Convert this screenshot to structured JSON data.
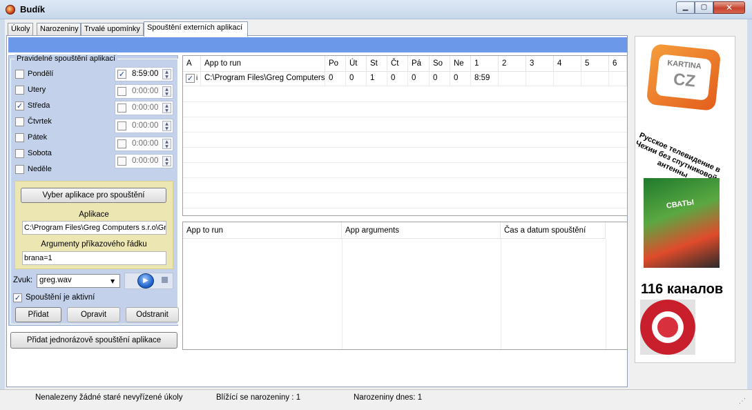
{
  "window": {
    "title": "Budík"
  },
  "tabs": [
    {
      "label": "Úkoly"
    },
    {
      "label": "Narozeniny"
    },
    {
      "label": "Trvalé upomínky"
    },
    {
      "label": "Spouštění externích aplikací"
    }
  ],
  "schedule": {
    "group_title": "Pravidelné spouštění aplikací",
    "days": [
      {
        "label": "Pondělí",
        "checked": false
      },
      {
        "label": "Utery",
        "checked": false
      },
      {
        "label": "Středa",
        "checked": true
      },
      {
        "label": "Čtvrtek",
        "checked": false
      },
      {
        "label": "Pátek",
        "checked": false
      },
      {
        "label": "Sobota",
        "checked": false
      },
      {
        "label": "Neděle",
        "checked": false
      }
    ],
    "times": [
      {
        "value": "8:59:00",
        "checked": true
      },
      {
        "value": "0:00:00",
        "checked": false
      },
      {
        "value": "0:00:00",
        "checked": false
      },
      {
        "value": "0:00:00",
        "checked": false
      },
      {
        "value": "0:00:00",
        "checked": false
      },
      {
        "value": "0:00:00",
        "checked": false
      }
    ],
    "choose_app_button": "Vyber aplikace pro spouštění",
    "app_label": "Aplikace",
    "app_value": "C:\\Program Files\\Greg Computers s.r.o\\Gre",
    "args_label": "Argumenty příkazového řádku",
    "args_value": "brana=1",
    "sound_label": "Zvuk:",
    "sound_value": "greg.wav",
    "active_label": "Spouštění je aktivní",
    "active_checked": true,
    "add_button": "Přidat",
    "edit_button": "Opravit",
    "remove_button": "Odstranit",
    "add_once_button": "Přidat jednorázově spouštění aplikace"
  },
  "top_grid": {
    "headers": [
      "A",
      "App to run",
      "Po",
      "Út",
      "St",
      "Čt",
      "Pá",
      "So",
      "Ne",
      "1",
      "2",
      "3",
      "4",
      "5",
      "6"
    ],
    "rows": [
      {
        "checked": true,
        "flag": "i",
        "cells": [
          "C:\\Program Files\\Greg Computers...",
          "0",
          "0",
          "1",
          "0",
          "0",
          "0",
          "0",
          "8:59",
          "",
          "",
          "",
          "",
          "",
          ""
        ]
      }
    ]
  },
  "bottom_grid": {
    "headers": [
      "App to run",
      "App arguments",
      "Čas a datum spouštění"
    ]
  },
  "ads": {
    "logo_line1": "KARTINA",
    "logo_line2": "CZ",
    "tagline": "Русское телевидение в Чехии без спутниковой антенны",
    "dvd_title": "СВАТЫ",
    "channels": "116 каналов"
  },
  "status": {
    "tasks": "Nenalezeny žádné staré nevyřízené úkoly",
    "birthdays_upcoming": "Blížící se narozeniny : 1",
    "birthdays_today": "Narozeniny dnes: 1"
  },
  "colors": {
    "accent_strip": "#6b98e8",
    "panel_bg": "#c3d2ea",
    "yellow_box": "#ece6b3"
  }
}
